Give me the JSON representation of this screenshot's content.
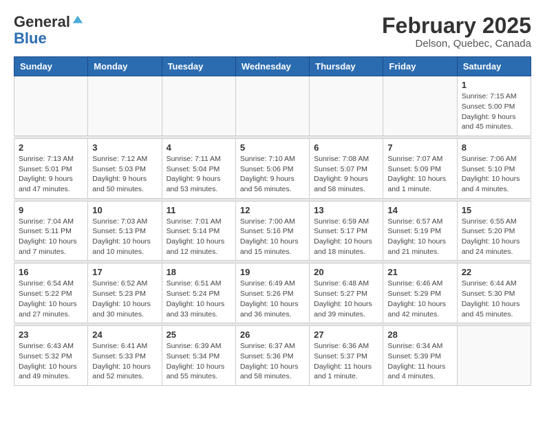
{
  "header": {
    "title": "February 2025",
    "location": "Delson, Quebec, Canada",
    "logo_general": "General",
    "logo_blue": "Blue"
  },
  "days_of_week": [
    "Sunday",
    "Monday",
    "Tuesday",
    "Wednesday",
    "Thursday",
    "Friday",
    "Saturday"
  ],
  "weeks": [
    {
      "days": [
        {
          "number": "",
          "info": ""
        },
        {
          "number": "",
          "info": ""
        },
        {
          "number": "",
          "info": ""
        },
        {
          "number": "",
          "info": ""
        },
        {
          "number": "",
          "info": ""
        },
        {
          "number": "",
          "info": ""
        },
        {
          "number": "1",
          "info": "Sunrise: 7:15 AM\nSunset: 5:00 PM\nDaylight: 9 hours and 45 minutes."
        }
      ]
    },
    {
      "days": [
        {
          "number": "2",
          "info": "Sunrise: 7:13 AM\nSunset: 5:01 PM\nDaylight: 9 hours and 47 minutes."
        },
        {
          "number": "3",
          "info": "Sunrise: 7:12 AM\nSunset: 5:03 PM\nDaylight: 9 hours and 50 minutes."
        },
        {
          "number": "4",
          "info": "Sunrise: 7:11 AM\nSunset: 5:04 PM\nDaylight: 9 hours and 53 minutes."
        },
        {
          "number": "5",
          "info": "Sunrise: 7:10 AM\nSunset: 5:06 PM\nDaylight: 9 hours and 56 minutes."
        },
        {
          "number": "6",
          "info": "Sunrise: 7:08 AM\nSunset: 5:07 PM\nDaylight: 9 hours and 58 minutes."
        },
        {
          "number": "7",
          "info": "Sunrise: 7:07 AM\nSunset: 5:09 PM\nDaylight: 10 hours and 1 minute."
        },
        {
          "number": "8",
          "info": "Sunrise: 7:06 AM\nSunset: 5:10 PM\nDaylight: 10 hours and 4 minutes."
        }
      ]
    },
    {
      "days": [
        {
          "number": "9",
          "info": "Sunrise: 7:04 AM\nSunset: 5:11 PM\nDaylight: 10 hours and 7 minutes."
        },
        {
          "number": "10",
          "info": "Sunrise: 7:03 AM\nSunset: 5:13 PM\nDaylight: 10 hours and 10 minutes."
        },
        {
          "number": "11",
          "info": "Sunrise: 7:01 AM\nSunset: 5:14 PM\nDaylight: 10 hours and 12 minutes."
        },
        {
          "number": "12",
          "info": "Sunrise: 7:00 AM\nSunset: 5:16 PM\nDaylight: 10 hours and 15 minutes."
        },
        {
          "number": "13",
          "info": "Sunrise: 6:59 AM\nSunset: 5:17 PM\nDaylight: 10 hours and 18 minutes."
        },
        {
          "number": "14",
          "info": "Sunrise: 6:57 AM\nSunset: 5:19 PM\nDaylight: 10 hours and 21 minutes."
        },
        {
          "number": "15",
          "info": "Sunrise: 6:55 AM\nSunset: 5:20 PM\nDaylight: 10 hours and 24 minutes."
        }
      ]
    },
    {
      "days": [
        {
          "number": "16",
          "info": "Sunrise: 6:54 AM\nSunset: 5:22 PM\nDaylight: 10 hours and 27 minutes."
        },
        {
          "number": "17",
          "info": "Sunrise: 6:52 AM\nSunset: 5:23 PM\nDaylight: 10 hours and 30 minutes."
        },
        {
          "number": "18",
          "info": "Sunrise: 6:51 AM\nSunset: 5:24 PM\nDaylight: 10 hours and 33 minutes."
        },
        {
          "number": "19",
          "info": "Sunrise: 6:49 AM\nSunset: 5:26 PM\nDaylight: 10 hours and 36 minutes."
        },
        {
          "number": "20",
          "info": "Sunrise: 6:48 AM\nSunset: 5:27 PM\nDaylight: 10 hours and 39 minutes."
        },
        {
          "number": "21",
          "info": "Sunrise: 6:46 AM\nSunset: 5:29 PM\nDaylight: 10 hours and 42 minutes."
        },
        {
          "number": "22",
          "info": "Sunrise: 6:44 AM\nSunset: 5:30 PM\nDaylight: 10 hours and 45 minutes."
        }
      ]
    },
    {
      "days": [
        {
          "number": "23",
          "info": "Sunrise: 6:43 AM\nSunset: 5:32 PM\nDaylight: 10 hours and 49 minutes."
        },
        {
          "number": "24",
          "info": "Sunrise: 6:41 AM\nSunset: 5:33 PM\nDaylight: 10 hours and 52 minutes."
        },
        {
          "number": "25",
          "info": "Sunrise: 6:39 AM\nSunset: 5:34 PM\nDaylight: 10 hours and 55 minutes."
        },
        {
          "number": "26",
          "info": "Sunrise: 6:37 AM\nSunset: 5:36 PM\nDaylight: 10 hours and 58 minutes."
        },
        {
          "number": "27",
          "info": "Sunrise: 6:36 AM\nSunset: 5:37 PM\nDaylight: 11 hours and 1 minute."
        },
        {
          "number": "28",
          "info": "Sunrise: 6:34 AM\nSunset: 5:39 PM\nDaylight: 11 hours and 4 minutes."
        },
        {
          "number": "",
          "info": ""
        }
      ]
    }
  ]
}
